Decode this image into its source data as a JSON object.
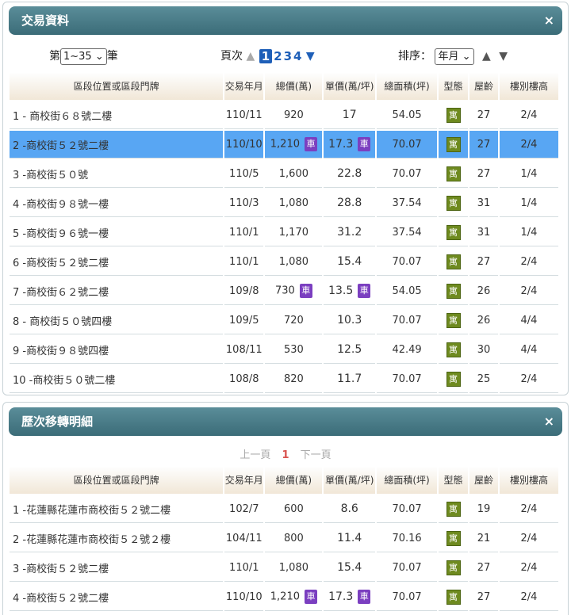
{
  "panel1": {
    "title": "交易資料",
    "close_icon": "×",
    "range": {
      "prefix": "第",
      "value": "1~35",
      "suffix": "筆"
    },
    "paging": {
      "label": "頁次",
      "pages": [
        "1",
        "2",
        "3",
        "4"
      ],
      "current": "1"
    },
    "sort": {
      "label": "排序：",
      "value": "年月"
    },
    "columns": [
      "區段位置或區段門牌",
      "交易年月",
      "總價(萬)",
      "單價(萬/坪)",
      "總面積(坪)",
      "型態",
      "屋齡",
      "樓別樓高"
    ],
    "rows": [
      {
        "addr": "1 - 商校街６８號二樓",
        "date": "110/11",
        "total": "920",
        "total_badge": "",
        "unit": "17",
        "unit_badge": "",
        "area": "54.05",
        "type": "寓",
        "age": "27",
        "floor": "2/4"
      },
      {
        "addr": "2 -商校街５２號二樓",
        "date": "110/10",
        "total": "1,210",
        "total_badge": "車",
        "unit": "17.3",
        "unit_badge": "車",
        "area": "70.07",
        "type": "寓",
        "age": "27",
        "floor": "2/4"
      },
      {
        "addr": "3 -商校街５０號",
        "date": "110/5",
        "total": "1,600",
        "total_badge": "",
        "unit": "22.8",
        "unit_badge": "",
        "area": "70.07",
        "type": "寓",
        "age": "27",
        "floor": "1/4"
      },
      {
        "addr": "4 -商校街９８號一樓",
        "date": "110/3",
        "total": "1,080",
        "total_badge": "",
        "unit": "28.8",
        "unit_badge": "",
        "area": "37.54",
        "type": "寓",
        "age": "31",
        "floor": "1/4"
      },
      {
        "addr": "5 -商校街９６號一樓",
        "date": "110/1",
        "total": "1,170",
        "total_badge": "",
        "unit": "31.2",
        "unit_badge": "",
        "area": "37.54",
        "type": "寓",
        "age": "31",
        "floor": "1/4"
      },
      {
        "addr": "6 -商校街５２號二樓",
        "date": "110/1",
        "total": "1,080",
        "total_badge": "",
        "unit": "15.4",
        "unit_badge": "",
        "area": "70.07",
        "type": "寓",
        "age": "27",
        "floor": "2/4"
      },
      {
        "addr": "7 -商校街６２號二樓",
        "date": "109/8",
        "total": "730",
        "total_badge": "車",
        "unit": "13.5",
        "unit_badge": "車",
        "area": "54.05",
        "type": "寓",
        "age": "26",
        "floor": "2/4"
      },
      {
        "addr": "8 - 商校街５０號四樓",
        "date": "109/5",
        "total": "720",
        "total_badge": "",
        "unit": "10.3",
        "unit_badge": "",
        "area": "70.07",
        "type": "寓",
        "age": "26",
        "floor": "4/4"
      },
      {
        "addr": "9 -商校街９８號四樓",
        "date": "108/11",
        "total": "530",
        "total_badge": "",
        "unit": "12.5",
        "unit_badge": "",
        "area": "42.49",
        "type": "寓",
        "age": "30",
        "floor": "4/4"
      },
      {
        "addr": "10 -商校街５０號二樓",
        "date": "108/8",
        "total": "820",
        "total_badge": "",
        "unit": "11.7",
        "unit_badge": "",
        "area": "70.07",
        "type": "寓",
        "age": "25",
        "floor": "2/4"
      }
    ]
  },
  "panel2": {
    "title": "歷次移轉明細",
    "close_icon": "×",
    "nav": {
      "prev": "上一頁",
      "page": "1",
      "next": "下一頁"
    },
    "columns": [
      "區段位置或區段門牌",
      "交易年月",
      "總價(萬)",
      "單價(萬/坪)",
      "總面積(坪)",
      "型態",
      "屋齡",
      "樓別樓高"
    ],
    "rows": [
      {
        "addr": "1 -花蓮縣花蓮市商校街５２號二樓",
        "date": "102/7",
        "total": "600",
        "total_badge": "",
        "unit": "8.6",
        "unit_badge": "",
        "area": "70.07",
        "type": "寓",
        "age": "19",
        "floor": "2/4"
      },
      {
        "addr": "2 -花蓮縣花蓮市商校街５２號２樓",
        "date": "104/11",
        "total": "800",
        "total_badge": "",
        "unit": "11.4",
        "unit_badge": "",
        "area": "70.16",
        "type": "寓",
        "age": "21",
        "floor": "2/4"
      },
      {
        "addr": "3 -商校街５２號二樓",
        "date": "110/1",
        "total": "1,080",
        "total_badge": "",
        "unit": "15.4",
        "unit_badge": "",
        "area": "70.07",
        "type": "寓",
        "age": "27",
        "floor": "2/4"
      },
      {
        "addr": "4 -商校街５２號二樓",
        "date": "110/10",
        "total": "1,210",
        "total_badge": "車",
        "unit": "17.3",
        "unit_badge": "車",
        "area": "70.07",
        "type": "寓",
        "age": "27",
        "floor": "2/4"
      }
    ]
  }
}
